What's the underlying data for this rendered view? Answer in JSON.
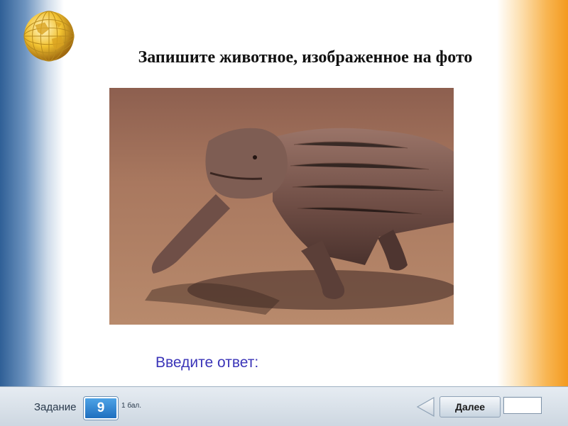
{
  "page": {
    "title": "Запишите животное, изображенное на фото"
  },
  "photo": {
    "subject": "komodo-dragon"
  },
  "answer": {
    "prompt": "Введите ответ:",
    "value": ""
  },
  "footer": {
    "task_label": "Задание",
    "task_number": "9",
    "points": "1 бал.",
    "next_label": "Далее"
  },
  "colors": {
    "left_band": "#2f5f96",
    "right_band": "#f39a1e",
    "prompt_text": "#3b35b8",
    "task_badge": "#1f6fbf"
  },
  "icons": {
    "logo": "globe-icon",
    "back": "triangle-left-icon"
  }
}
